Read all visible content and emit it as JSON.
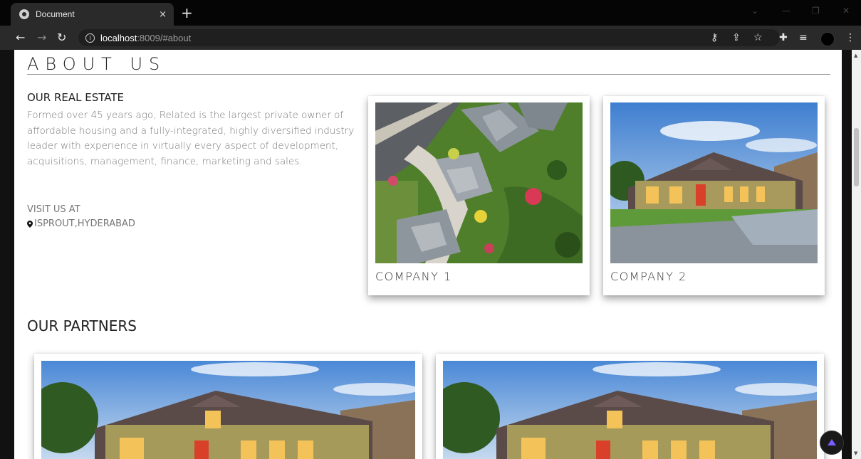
{
  "browser": {
    "tab_title": "Document",
    "tab_close": "×",
    "new_tab": "+",
    "url_host": "localhost",
    "url_rest": ":8009/#about",
    "icons": [
      "back-icon",
      "forward-icon",
      "reload-icon",
      "info-icon",
      "key-icon",
      "share-icon",
      "star-icon",
      "extensions-icon",
      "reading-list-icon",
      "profile-icon",
      "menu-icon"
    ]
  },
  "about": {
    "title": "ABOUT US",
    "estate_heading": "OUR REAL ESTATE",
    "estate_text": "Formed over 45 years ago, Related is the largest private owner of affordable housing and a fully-integrated, highly diversified industry leader with experience in virtually every aspect of development, acquisitions, management, finance, marketing and sales.",
    "visit_label": "VISIT US AT",
    "location": "ISPROUT,HYDERABAD"
  },
  "companies": [
    {
      "caption": "COMPANY 1",
      "image": "aerial-neighborhood-photo"
    },
    {
      "caption": "COMPANY 2",
      "image": "house-photo"
    }
  ],
  "partners": {
    "heading": "OUR PARTNERS",
    "items": [
      {
        "image": "house-photo"
      },
      {
        "image": "house-photo"
      }
    ]
  },
  "colors": {
    "page_bg": "#ffffff",
    "chrome_dark": "#2a2a2a",
    "text_dark": "#222222",
    "text_muted": "#777777",
    "back_to_top_arrow": "#7b5cff"
  }
}
